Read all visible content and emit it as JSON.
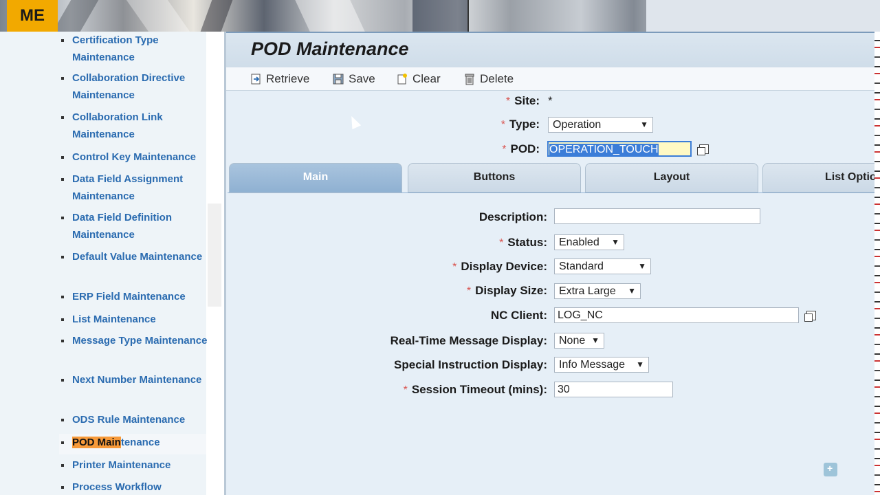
{
  "banner": {
    "logo": "ME"
  },
  "nav": {
    "items": [
      {
        "label": "Certification Type Maintenance"
      },
      {
        "label": "Collaboration Directive Maintenance"
      },
      {
        "label": "Collaboration Link Maintenance"
      },
      {
        "label": "Control Key Maintenance"
      },
      {
        "label": "Data Field Assignment Maintenance"
      },
      {
        "label": "Data Field Definition Maintenance"
      },
      {
        "label": "Default Value Maintenance"
      },
      {
        "label": "ERP Field Maintenance"
      },
      {
        "label": "List Maintenance"
      },
      {
        "label": "Message Type Maintenance"
      },
      {
        "label": "Next Number Maintenance"
      },
      {
        "label": "ODS Rule Maintenance"
      },
      {
        "label_hl": "POD Main",
        "label_rest": "tenance"
      },
      {
        "label": "Printer Maintenance"
      },
      {
        "label": "Process Workflow"
      }
    ]
  },
  "page": {
    "title": "POD Maintenance"
  },
  "toolbar": {
    "retrieve": "Retrieve",
    "save": "Save",
    "clear": "Clear",
    "delete": "Delete"
  },
  "header_fields": {
    "site_label": "Site:",
    "site_value": "*",
    "type_label": "Type:",
    "type_value": "Operation",
    "pod_label": "POD:",
    "pod_value": "OPERATION_TOUCH"
  },
  "tabs": [
    {
      "label": "Main"
    },
    {
      "label": "Buttons"
    },
    {
      "label": "Layout"
    },
    {
      "label": "List Optio"
    }
  ],
  "form": {
    "description_label": "Description:",
    "description_value": "",
    "status_label": "Status:",
    "status_value": "Enabled",
    "display_device_label": "Display Device:",
    "display_device_value": "Standard",
    "display_size_label": "Display Size:",
    "display_size_value": "Extra Large",
    "nc_client_label": "NC Client:",
    "nc_client_value": "LOG_NC",
    "rt_msg_label": "Real-Time Message Display:",
    "rt_msg_value": "None",
    "special_instr_label": "Special Instruction Display:",
    "special_instr_value": "Info Message",
    "session_timeout_label": "Session Timeout (mins):",
    "session_timeout_value": "30"
  },
  "icons": {
    "retrieve": "retrieve-icon",
    "save": "save-icon",
    "clear": "clear-icon",
    "delete": "delete-icon",
    "browse": "browse-icon",
    "dropdown": "chevron-down-icon"
  },
  "colors": {
    "accent": "#f2a900",
    "nav_text": "#2a6bb0",
    "active_tab": "#8fb1d2",
    "highlight": "#f79a3a"
  }
}
